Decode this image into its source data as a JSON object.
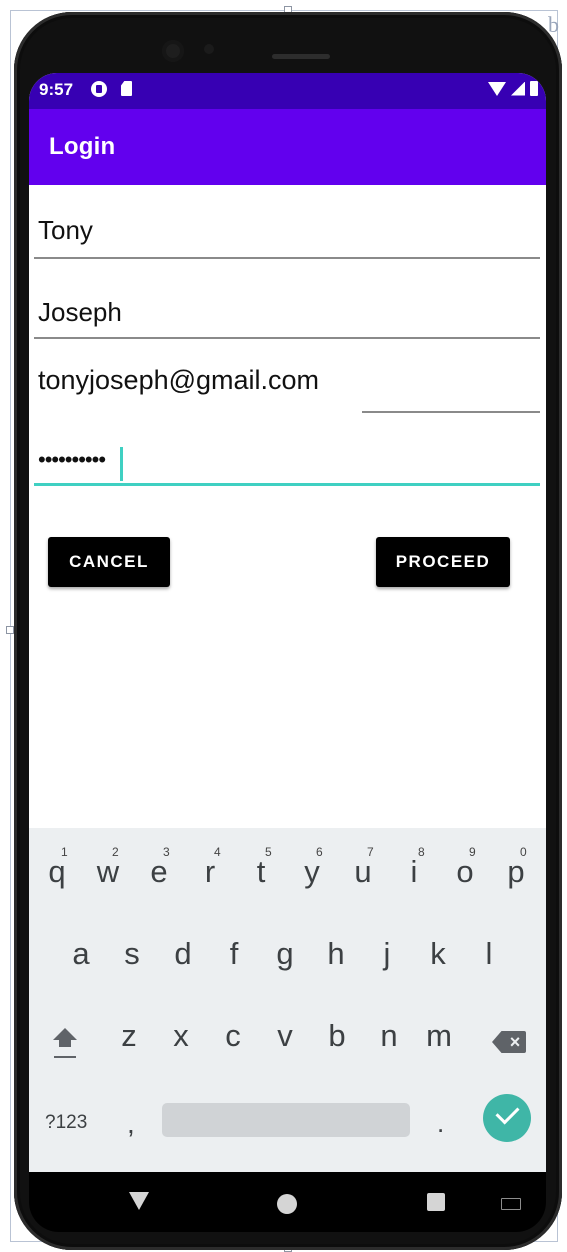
{
  "status_bar": {
    "time": "9:57",
    "icons": [
      "play-protect-icon",
      "sd-card-icon",
      "wifi-icon",
      "signal-icon",
      "battery-icon"
    ]
  },
  "app_bar": {
    "title": "Login"
  },
  "form": {
    "first_name": "Tony",
    "last_name": "Joseph",
    "email": "tonyjoseph@gmail.com",
    "password": "••••••••••"
  },
  "buttons": {
    "cancel": "CANCEL",
    "proceed": "PROCEED"
  },
  "keyboard": {
    "row1": [
      {
        "key": "q",
        "hint": "1"
      },
      {
        "key": "w",
        "hint": "2"
      },
      {
        "key": "e",
        "hint": "3"
      },
      {
        "key": "r",
        "hint": "4"
      },
      {
        "key": "t",
        "hint": "5"
      },
      {
        "key": "y",
        "hint": "6"
      },
      {
        "key": "u",
        "hint": "7"
      },
      {
        "key": "i",
        "hint": "8"
      },
      {
        "key": "o",
        "hint": "9"
      },
      {
        "key": "p",
        "hint": "0"
      }
    ],
    "row2": [
      "a",
      "s",
      "d",
      "f",
      "g",
      "h",
      "j",
      "k",
      "l"
    ],
    "row3": [
      "z",
      "x",
      "c",
      "v",
      "b",
      "n",
      "m"
    ],
    "symbols_key": "?123",
    "comma": ",",
    "period": "."
  },
  "colors": {
    "status_bar": "#3700b3",
    "app_bar": "#6200ee",
    "accent": "#3fd0c2",
    "button": "#000000"
  }
}
